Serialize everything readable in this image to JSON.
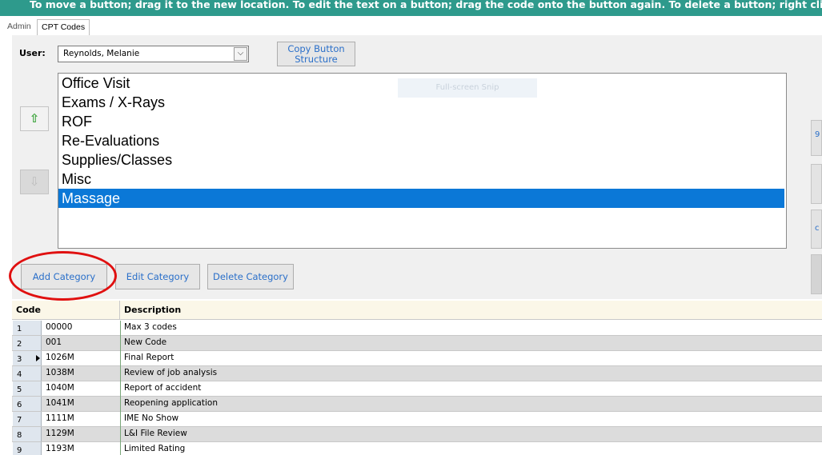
{
  "banner": {
    "text": "To move a button; drag it to the new location. To edit the text on a button; drag the code onto the button again.  To delete a button; right click on it and"
  },
  "tabs": [
    {
      "label": "Admin",
      "active": false
    },
    {
      "label": "CPT Codes",
      "active": true
    }
  ],
  "user": {
    "label": "User:",
    "selected": "Reynolds, Melanie",
    "dropdown_icon": "chevron-down-icon"
  },
  "copy_button": {
    "label_line1": "Copy Button",
    "label_line2": "Structure"
  },
  "arrows": {
    "up_icon": "arrow-up-icon",
    "down_icon": "arrow-down-icon"
  },
  "categories": [
    {
      "label": "Office Visit",
      "selected": false
    },
    {
      "label": "Exams / X-Rays",
      "selected": false
    },
    {
      "label": "ROF",
      "selected": false
    },
    {
      "label": "Re-Evaluations",
      "selected": false
    },
    {
      "label": "Supplies/Classes",
      "selected": false
    },
    {
      "label": "Misc",
      "selected": false
    },
    {
      "label": "Massage",
      "selected": true
    }
  ],
  "overlay": {
    "snip_label": "Full-screen Snip"
  },
  "category_buttons": {
    "add": "Add Category",
    "edit": "Edit Category",
    "delete": "Delete Category"
  },
  "side_buttons": [
    "9",
    "",
    "c",
    ""
  ],
  "grid": {
    "columns": [
      "Code",
      "Description"
    ],
    "rows": [
      {
        "num": "1",
        "code": "00000",
        "desc": "Max 3 codes",
        "current": false
      },
      {
        "num": "2",
        "code": "001",
        "desc": "New Code",
        "current": false
      },
      {
        "num": "3",
        "code": "1026M",
        "desc": "Final Report",
        "current": true
      },
      {
        "num": "4",
        "code": "1038M",
        "desc": "Review of job analysis",
        "current": false
      },
      {
        "num": "5",
        "code": "1040M",
        "desc": "Report of accident",
        "current": false
      },
      {
        "num": "6",
        "code": "1041M",
        "desc": "Reopening application",
        "current": false
      },
      {
        "num": "7",
        "code": "1111M",
        "desc": "IME No Show",
        "current": false
      },
      {
        "num": "8",
        "code": "1129M",
        "desc": "L&I File Review",
        "current": false
      },
      {
        "num": "9",
        "code": "1193M",
        "desc": "Limited Rating",
        "current": false
      }
    ]
  },
  "colors": {
    "banner": "#2e9a8c",
    "selection": "#0b78d7",
    "highlight_circle": "#e01010",
    "button_text": "#2a6fc9"
  }
}
